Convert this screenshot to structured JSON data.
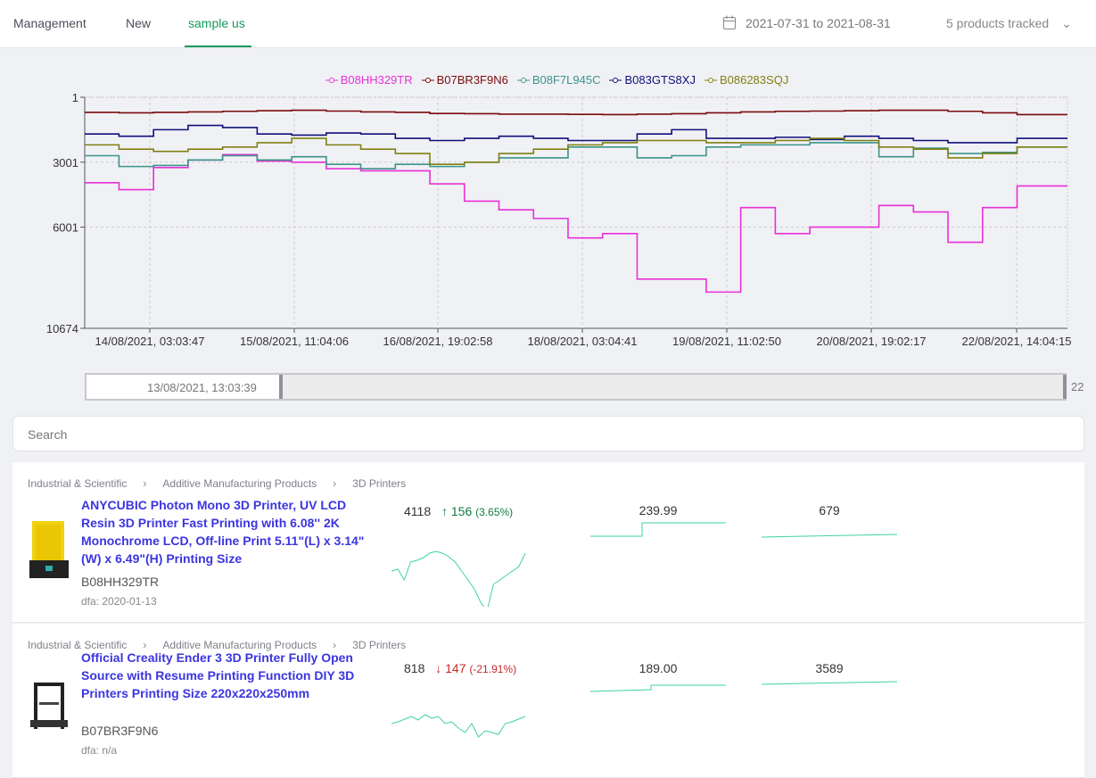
{
  "nav": {
    "tabs": [
      {
        "label": "Management"
      },
      {
        "label": "New"
      },
      {
        "label": "sample us",
        "active": true
      }
    ],
    "date_range": "2021-07-31 to 2021-08-31",
    "tracked": "5 products tracked",
    "accent": "#149a5a"
  },
  "chart_data": {
    "type": "line",
    "step": true,
    "y_inverted": true,
    "grid": true,
    "legend": "top-center",
    "ylim": [
      1,
      10674
    ],
    "yticks": [
      "1",
      "3001",
      "6001",
      "10674"
    ],
    "xticks": [
      "14/08/2021, 03:03:47",
      "15/08/2021, 11:04:06",
      "16/08/2021, 19:02:58",
      "18/08/2021, 03:04:41",
      "19/08/2021, 11:02:50",
      "20/08/2021, 19:02:17",
      "22/08/2021, 14:04:15"
    ],
    "x": [
      "2021-08-13 13:00",
      "2021-08-13 21:00",
      "2021-08-14 05:00",
      "2021-08-14 13:00",
      "2021-08-14 21:00",
      "2021-08-15 05:00",
      "2021-08-15 13:00",
      "2021-08-15 21:00",
      "2021-08-16 05:00",
      "2021-08-16 13:00",
      "2021-08-16 21:00",
      "2021-08-17 05:00",
      "2021-08-17 13:00",
      "2021-08-17 21:00",
      "2021-08-18 05:00",
      "2021-08-18 13:00",
      "2021-08-18 21:00",
      "2021-08-19 05:00",
      "2021-08-19 13:00",
      "2021-08-19 21:00",
      "2021-08-20 05:00",
      "2021-08-20 13:00",
      "2021-08-20 21:00",
      "2021-08-21 05:00",
      "2021-08-21 13:00",
      "2021-08-21 21:00",
      "2021-08-22 05:00",
      "2021-08-22 13:00"
    ],
    "series": [
      {
        "name": "B08HH329TR",
        "color": "#e830d8",
        "values": [
          3950,
          4270,
          3250,
          2900,
          2650,
          2950,
          3000,
          3300,
          3400,
          3400,
          4000,
          4800,
          5200,
          5600,
          6500,
          6300,
          8400,
          8400,
          9000,
          5100,
          6300,
          6000,
          6000,
          5000,
          5300,
          6700,
          5100,
          4100
        ]
      },
      {
        "name": "B07BR3F9N6",
        "color": "#7a0a0a",
        "values": [
          700,
          720,
          700,
          680,
          650,
          620,
          600,
          640,
          680,
          700,
          750,
          760,
          780,
          780,
          790,
          800,
          780,
          760,
          720,
          680,
          650,
          640,
          620,
          600,
          600,
          650,
          720,
          800
        ]
      },
      {
        "name": "B08F7L945C",
        "color": "#3a9488",
        "values": [
          2700,
          3200,
          3150,
          2900,
          2700,
          2900,
          2750,
          3100,
          3300,
          3100,
          3200,
          3000,
          2800,
          2800,
          2300,
          2300,
          2800,
          2700,
          2300,
          2200,
          2200,
          2100,
          2100,
          2750,
          2350,
          2600,
          2550,
          2300
        ]
      },
      {
        "name": "B083GTS8XJ",
        "color": "#10107a",
        "values": [
          1700,
          1800,
          1500,
          1300,
          1400,
          1700,
          1750,
          1650,
          1700,
          1900,
          2000,
          1900,
          1800,
          1900,
          2000,
          2000,
          1700,
          1500,
          1900,
          1900,
          1850,
          1950,
          1800,
          1900,
          2000,
          2100,
          2100,
          1900
        ]
      },
      {
        "name": "B086283SQJ",
        "color": "#808010",
        "values": [
          2200,
          2400,
          2500,
          2400,
          2300,
          2100,
          1900,
          2200,
          2400,
          2600,
          3100,
          3000,
          2600,
          2400,
          2200,
          2100,
          2000,
          2000,
          2100,
          2100,
          2000,
          1900,
          2000,
          2300,
          2400,
          2800,
          2600,
          2300
        ]
      }
    ]
  },
  "slider": {
    "start_label": "13/08/2021, 13:03:39",
    "end_label": "22"
  },
  "search": {
    "placeholder": "Search"
  },
  "products": [
    {
      "crumbs": [
        "Industrial & Scientific",
        "Additive Manufacturing Products",
        "3D Printers"
      ],
      "title": "ANYCUBIC Photon Mono 3D Printer, UV LCD Resin 3D Printer Fast Printing with 6.08'' 2K Monochrome LCD, Off-line Print 5.11\"(L) x 3.14\"(W) x 6.49\"(H) Printing Size",
      "asin": "B08HH329TR",
      "dfa": "dfa: 2020-01-13",
      "rank": "4118",
      "change": "156",
      "change_pct": "(3.65%)",
      "direction": "up",
      "price": "239.99",
      "reviews": "679",
      "spark": [
        40,
        38,
        50,
        30,
        28,
        25,
        20,
        18,
        20,
        24,
        30,
        40,
        50,
        60,
        75,
        85,
        55,
        50,
        45,
        40,
        35,
        20
      ]
    },
    {
      "crumbs": [
        "Industrial & Scientific",
        "Additive Manufacturing Products",
        "3D Printers"
      ],
      "title": "Official Creality Ender 3 3D Printer Fully Open Source with Resume Printing Function DIY 3D Printers Printing Size 220x220x250mm",
      "asin": "B07BR3F9N6",
      "dfa": "dfa: n/a",
      "rank": "818",
      "change": "147",
      "change_pct": "(-21.91%)",
      "direction": "down",
      "price": "189.00",
      "reviews": "3589",
      "spark": [
        30,
        28,
        25,
        22,
        26,
        20,
        24,
        22,
        30,
        28,
        35,
        40,
        30,
        45,
        38,
        40,
        42,
        30,
        28,
        25,
        22
      ]
    }
  ]
}
